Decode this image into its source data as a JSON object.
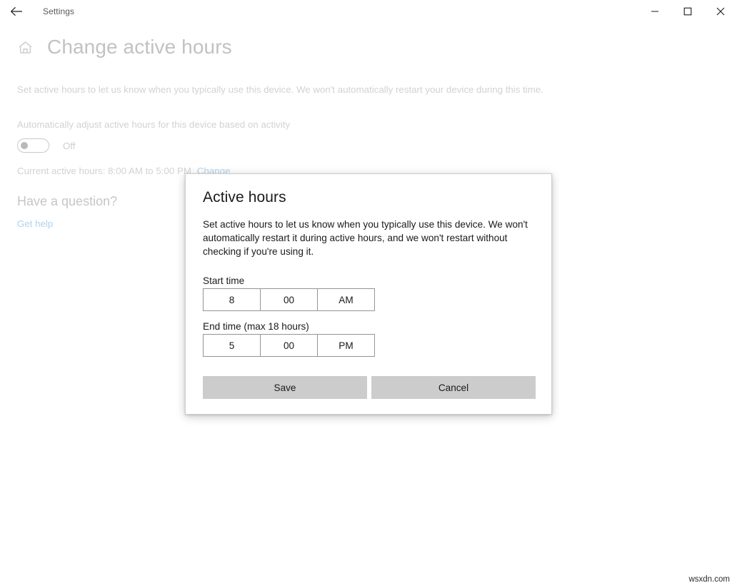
{
  "window": {
    "app_title": "Settings",
    "back_icon": "back-arrow-icon",
    "minimize_label": "−",
    "maximize_label": "□",
    "close_label": "✕"
  },
  "page": {
    "home_icon": "home-icon",
    "title": "Change active hours",
    "description": "Set active hours to let us know when you typically use this device. We won't automatically restart your device during this time.",
    "auto_adjust_label": "Automatically adjust active hours for this device based on activity",
    "toggle_state": "Off",
    "current_hours": "Current active hours: 8:00 AM to 5:00 PM",
    "change_link": "Change",
    "have_question": "Have a question?",
    "get_help": "Get help"
  },
  "dialog": {
    "title": "Active hours",
    "description": "Set active hours to let us know when you typically use this device. We won't automatically restart it during active hours, and we won't restart without checking if you're using it.",
    "start_label": "Start time",
    "end_label": "End time (max 18 hours)",
    "start_time": {
      "hour": "8",
      "minute": "00",
      "meridiem": "AM"
    },
    "end_time": {
      "hour": "5",
      "minute": "00",
      "meridiem": "PM"
    },
    "save_label": "Save",
    "cancel_label": "Cancel"
  },
  "watermark": "wsxdn.com",
  "colors": {
    "accent_link": "#add2ee",
    "dialog_button": "#cccccc",
    "field_border": "#949494",
    "muted_text": "#d2d2d2"
  }
}
